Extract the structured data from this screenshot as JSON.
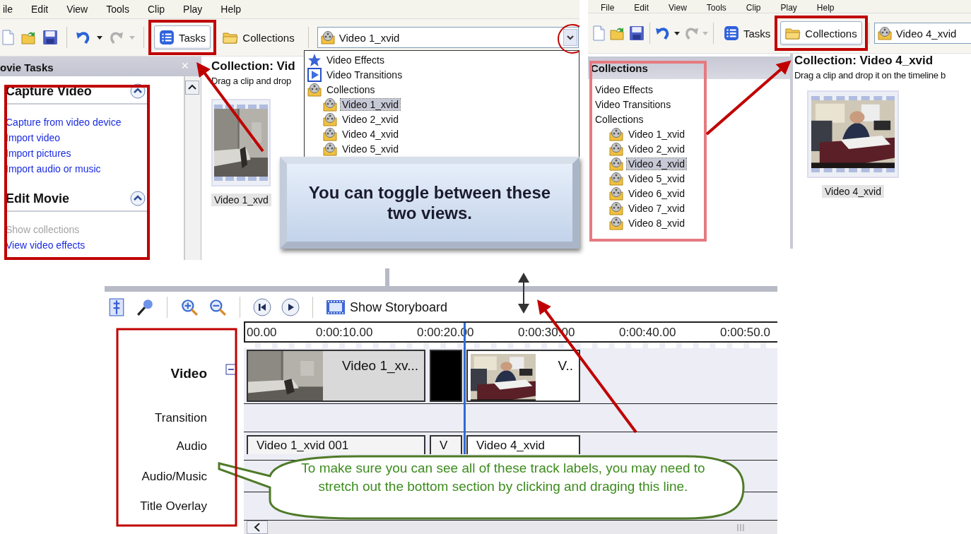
{
  "left_view": {
    "menu": [
      "ile",
      "Edit",
      "View",
      "Tools",
      "Clip",
      "Play",
      "Help"
    ],
    "toolbar": {
      "buttons": [
        {
          "label": "Tasks",
          "kind": "tasks",
          "selected": true
        },
        {
          "label": "Collections",
          "kind": "collections",
          "selected": false
        }
      ],
      "dropdown": {
        "value": "Video 1_xvid",
        "open": true,
        "items": [
          {
            "label": "Video Effects",
            "kind": "effects",
            "selected": false
          },
          {
            "label": "Video Transitions",
            "kind": "transitions",
            "selected": false
          },
          {
            "label": "Collections",
            "kind": "collection",
            "selected": false,
            "children": [
              {
                "label": "Video 1_xvid",
                "kind": "collection",
                "selected": true
              },
              {
                "label": "Video 2_xvid",
                "kind": "collection",
                "selected": false
              },
              {
                "label": "Video 4_xvid",
                "kind": "collection",
                "selected": false
              },
              {
                "label": "Video 5_xvid",
                "kind": "collection",
                "selected": false
              }
            ]
          }
        ]
      }
    },
    "task_pane": {
      "title": "ovie Tasks",
      "close": "×",
      "sections": [
        {
          "title": "Capture Video",
          "expanded": true,
          "links": [
            {
              "label": "Capture from video device",
              "disabled": false
            },
            {
              "label": "Import video",
              "disabled": false
            },
            {
              "label": "Import pictures",
              "disabled": false
            },
            {
              "label": "Import audio or music",
              "disabled": false
            }
          ]
        },
        {
          "title": "Edit Movie",
          "expanded": true,
          "links": [
            {
              "label": "Show collections",
              "disabled": true
            },
            {
              "label": "View video effects",
              "disabled": false
            }
          ]
        }
      ]
    },
    "collection": {
      "title": "Collection: Vid",
      "hint": "Drag a clip and drop",
      "clips": [
        {
          "label": "Video 1_xvd"
        }
      ]
    }
  },
  "right_view": {
    "menu": [
      "File",
      "Edit",
      "View",
      "Tools",
      "Clip",
      "Play",
      "Help"
    ],
    "toolbar": {
      "buttons": [
        {
          "label": "Tasks",
          "kind": "tasks",
          "selected": false
        },
        {
          "label": "Collections",
          "kind": "collections",
          "selected": true
        }
      ],
      "dropdown": {
        "value": "Video 4_xvid"
      }
    },
    "tree": {
      "title": "Collections",
      "items": [
        {
          "label": "Video Effects",
          "selected": false
        },
        {
          "label": "Video Transitions",
          "selected": false
        },
        {
          "label": "Collections",
          "selected": false,
          "children": [
            {
              "label": "Video 1_xvid",
              "kind": "collection",
              "selected": false
            },
            {
              "label": "Video 2_xvid",
              "kind": "collection",
              "selected": false
            },
            {
              "label": "Video 4_xvid",
              "kind": "collection",
              "selected": true
            },
            {
              "label": "Video 5_xvid",
              "kind": "collection",
              "selected": false
            },
            {
              "label": "Video 6_xvid",
              "kind": "collection",
              "selected": false
            },
            {
              "label": "Video 7_xvid",
              "kind": "collection",
              "selected": false
            },
            {
              "label": "Video 8_xvid",
              "kind": "collection",
              "selected": false
            }
          ]
        }
      ]
    },
    "collection": {
      "title": "Collection: Video 4_xvid",
      "hint": "Drag a clip and drop it on the timeline b",
      "clips": [
        {
          "label": "Video 4_xvid"
        }
      ]
    }
  },
  "timeline": {
    "storyboard_button": "Show Storyboard",
    "video_expanded": true,
    "ruler": [
      "00.00",
      "0:00:10.00",
      "0:00:20.00",
      "0:00:30.00",
      "0:00:40.00",
      "0:00:50.0"
    ],
    "tracks": [
      "Video",
      "Transition",
      "Audio",
      "Audio/Music",
      "Title Overlay"
    ],
    "video_clips": [
      {
        "kind": "clip",
        "label": "Video 1_xv..."
      },
      {
        "kind": "transition"
      },
      {
        "kind": "clip",
        "label": "V.."
      }
    ],
    "audio_clips": [
      {
        "label": "Video 1_xvid 001"
      },
      {
        "label": "V"
      },
      {
        "label": "Video 4_xvid"
      }
    ]
  },
  "callouts": [
    {
      "kind": "box",
      "text": "You can toggle between these two views."
    },
    {
      "kind": "bubble",
      "text": "To make sure you can see all of these track labels, you may need to stretch out the bottom section by clicking and draging this line."
    }
  ]
}
